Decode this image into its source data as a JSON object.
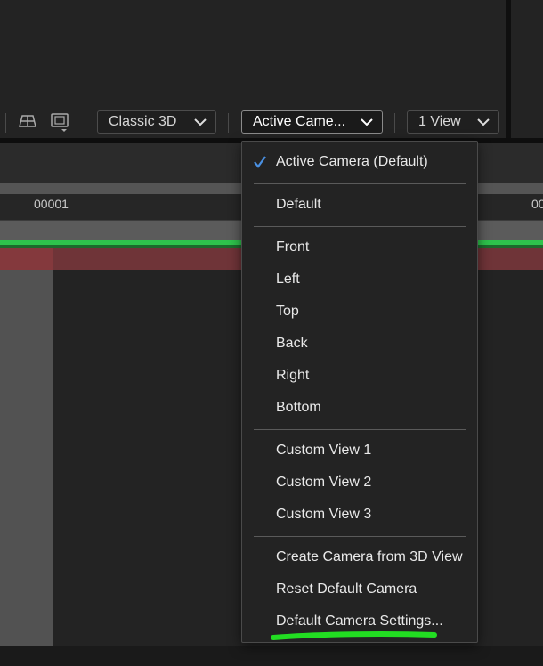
{
  "toolbar": {
    "renderer": "Classic 3D",
    "view": "Active Came...",
    "layout": "1 View"
  },
  "timeline": {
    "ticks": [
      "00001",
      "00"
    ]
  },
  "menu": {
    "items": [
      {
        "label": "Active Camera (Default)",
        "checked": true
      },
      {
        "label": "Default"
      },
      {
        "label": "Front"
      },
      {
        "label": "Left"
      },
      {
        "label": "Top"
      },
      {
        "label": "Back"
      },
      {
        "label": "Right"
      },
      {
        "label": "Bottom"
      },
      {
        "label": "Custom View 1"
      },
      {
        "label": "Custom View 2"
      },
      {
        "label": "Custom View 3"
      },
      {
        "label": "Create Camera from 3D View"
      },
      {
        "label": "Reset Default Camera"
      },
      {
        "label": "Default Camera Settings..."
      }
    ]
  },
  "colors": {
    "accent_check": "#4a90e2",
    "annotation_green": "#22dd22"
  }
}
